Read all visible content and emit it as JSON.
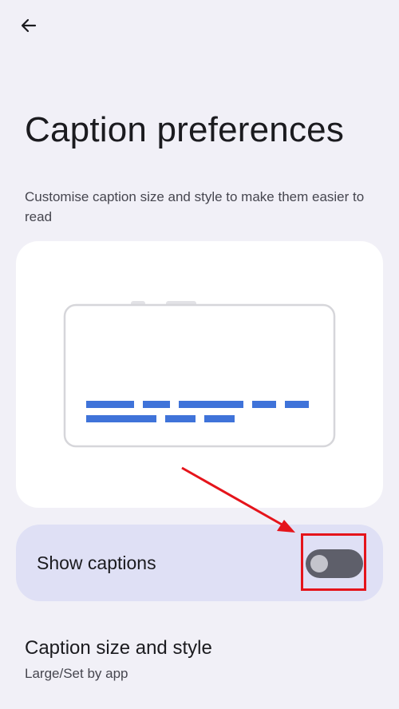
{
  "header": {
    "back_icon": "arrow-left-icon"
  },
  "page": {
    "title": "Caption preferences",
    "subtitle": "Customise caption size and style to make them easier to read"
  },
  "preview": {
    "caption_bar_color": "#3f73d9"
  },
  "show_captions": {
    "label": "Show captions",
    "enabled": false
  },
  "caption_size_style": {
    "title": "Caption size and style",
    "summary": "Large/Set by app"
  },
  "annotation": {
    "color": "#e5141b"
  }
}
